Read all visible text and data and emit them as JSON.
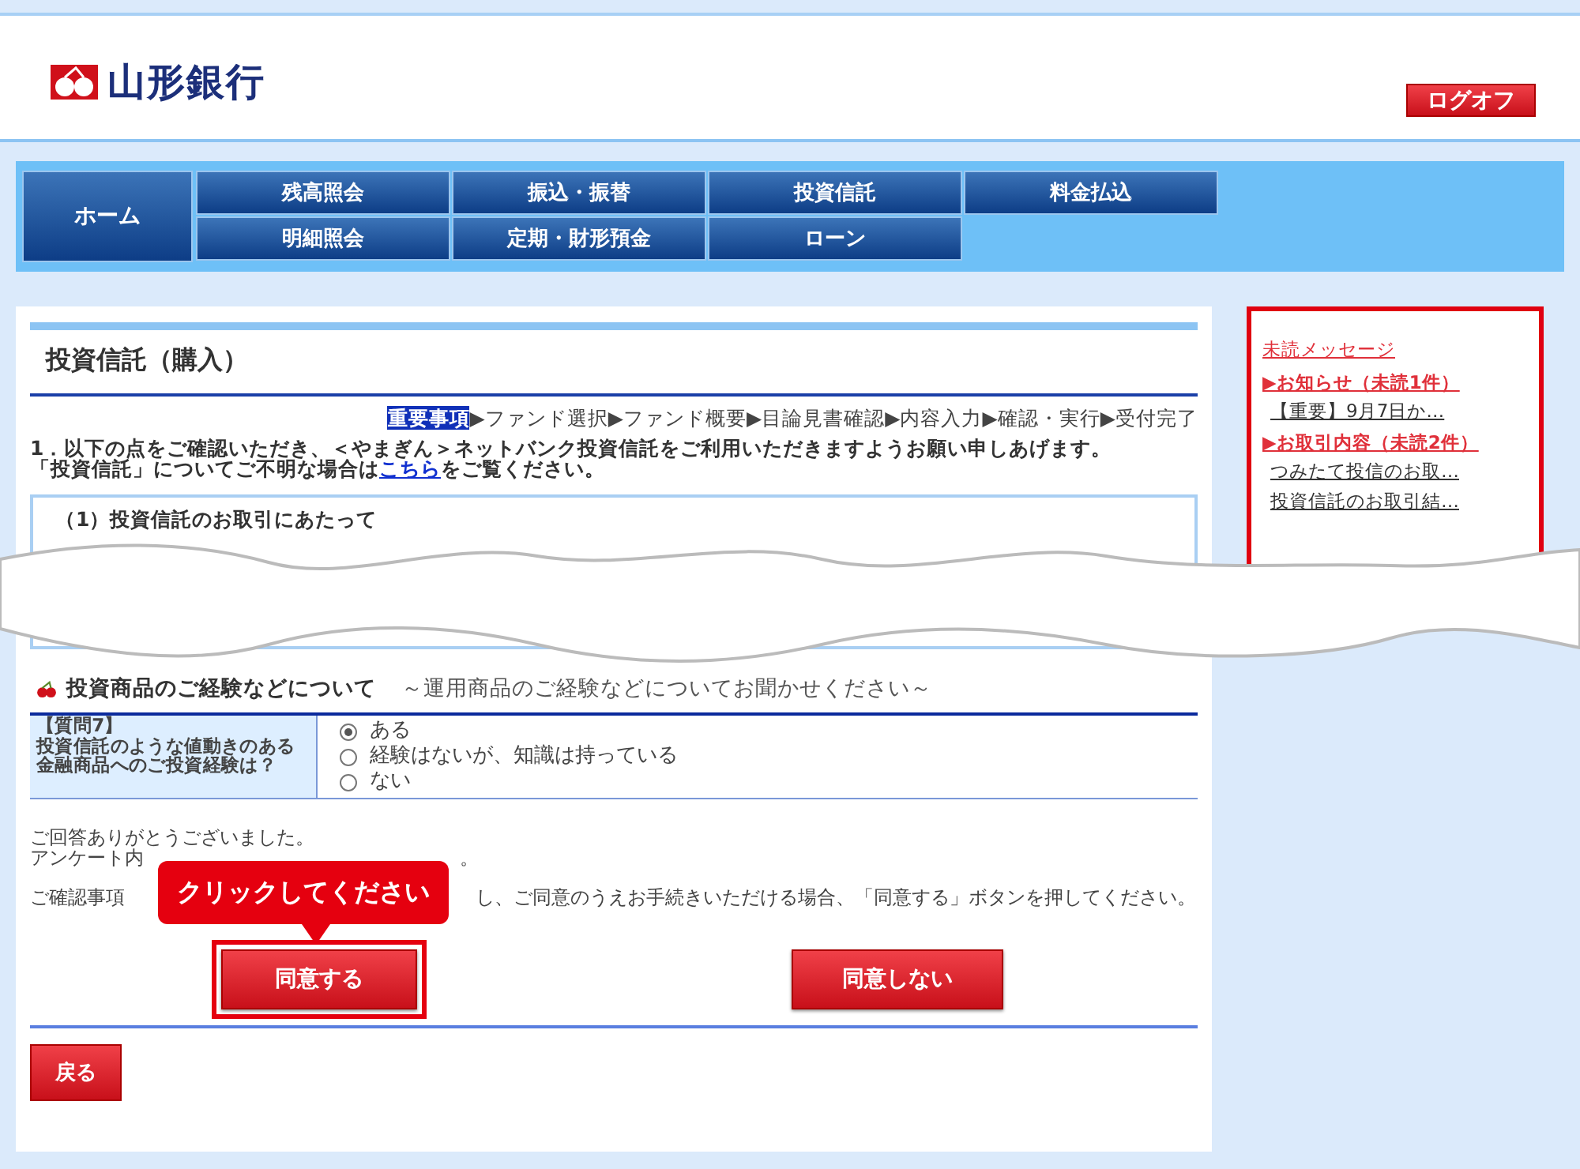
{
  "header": {
    "bank_name": "山形銀行",
    "logoff_button": "ログオフ"
  },
  "nav": {
    "home": "ホーム",
    "items": [
      {
        "label": "残高照会"
      },
      {
        "label": "振込・振替"
      },
      {
        "label": "投資信託"
      },
      {
        "label": "料金払込"
      },
      {
        "label": "明細照会"
      },
      {
        "label": "定期・財形預金"
      },
      {
        "label": "ローン"
      }
    ]
  },
  "page": {
    "title": "投資信託（購入）",
    "steps": [
      {
        "label": "重要事項",
        "selected": true
      },
      {
        "label": "▶ファンド選択",
        "selected": false
      },
      {
        "label": "▶ファンド概要",
        "selected": false
      },
      {
        "label": "▶目論見書確認",
        "selected": false
      },
      {
        "label": "▶内容入力",
        "selected": false
      },
      {
        "label": "▶確認・実行",
        "selected": false
      },
      {
        "label": "▶受付完了",
        "selected": false
      }
    ],
    "intro_line": "1．以下の点をご確認いただき、＜やまぎん＞ネットバンク投資信託をご利用いただきますようお願い申しあげます。",
    "help_before": "「投資信託」についてご不明な場合は",
    "help_link": "こちら",
    "help_after": "をご覧ください。",
    "box_title": "（1）投資信託のお取引にあたって",
    "section_title": "投資商品のご経験などについて",
    "section_subtitle": "～運用商品のご経験などについてお聞かせください～",
    "question": {
      "label": "【質問7】",
      "text": "投資信託のような値動きのある金融商品へのご投資経験は？",
      "options": [
        {
          "label": "ある",
          "selected": true
        },
        {
          "label": "経験はないが、知識は持っている",
          "selected": false
        },
        {
          "label": "ない",
          "selected": false
        }
      ]
    },
    "thanks": "ご回答ありがとうございました。",
    "survey_start": "アンケート内",
    "survey_end": "。",
    "confirm_start": "ご確認事項",
    "confirm_end": "し、ご同意のうえお手続きいただける場合、「同意する」ボタンを押してください。",
    "agree_button": {
      "label": "同意する",
      "highlighted": true
    },
    "disagree_button": {
      "label": "同意しない",
      "highlighted": false
    },
    "back_button": "戻る",
    "callout": "クリックしてください"
  },
  "sidebar": {
    "title": "未読メッセージ",
    "groups": [
      {
        "heading": "▶お知らせ（未読1件）",
        "items": [
          "【重要】9月7日か…"
        ]
      },
      {
        "heading": "▶お取引内容（未読2件）",
        "items": [
          "つみたて投信のお取…",
          "投資信託のお取引結…"
        ]
      }
    ]
  }
}
